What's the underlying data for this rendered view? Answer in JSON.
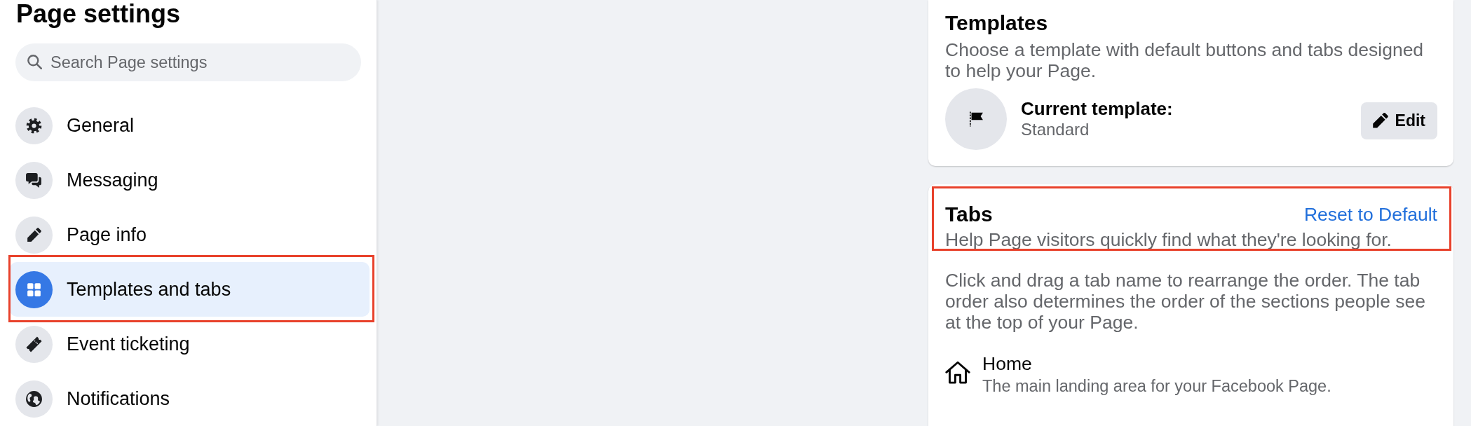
{
  "sidebar": {
    "title": "Page settings",
    "search": {
      "placeholder": "Search Page settings"
    },
    "items": [
      {
        "label": "General",
        "selected": false,
        "annotated": false
      },
      {
        "label": "Messaging",
        "selected": false,
        "annotated": false
      },
      {
        "label": "Page info",
        "selected": false,
        "annotated": false
      },
      {
        "label": "Templates and tabs",
        "selected": true,
        "annotated": true
      },
      {
        "label": "Event ticketing",
        "selected": false,
        "annotated": false
      },
      {
        "label": "Notifications",
        "selected": false,
        "annotated": false
      }
    ]
  },
  "templates_card": {
    "title": "Templates",
    "description": "Choose a template with default buttons and tabs designed to help your Page.",
    "current_label": "Current template:",
    "current_value": "Standard",
    "edit_button": "Edit"
  },
  "tabs_card": {
    "title": "Tabs",
    "annotated": true,
    "reset_link": "Reset to Default",
    "subtitle": "Help Page visitors quickly find what they're looking for.",
    "instructions": "Click and drag a tab name to rearrange the order. The tab order also determines the order of the sections people see at the top of your Page.",
    "tabs": [
      {
        "name": "Home",
        "description": "The main landing area for your Facebook Page."
      }
    ]
  }
}
